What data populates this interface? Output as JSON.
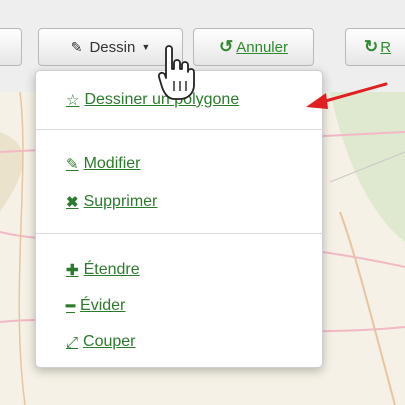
{
  "toolbar": {
    "dessin_label": "Dessin",
    "annuler_label": "Annuler",
    "redo_label": "R"
  },
  "menu": {
    "items": [
      {
        "label": "Dessiner un polygone",
        "icon": "star-icon"
      },
      {
        "label": "Modifier",
        "icon": "edit-icon"
      },
      {
        "label": "Supprimer",
        "icon": "close-icon"
      },
      {
        "label": "Étendre",
        "icon": "plus-icon"
      },
      {
        "label": "Évider",
        "icon": "minus-icon"
      },
      {
        "label": "Couper",
        "icon": "cut-icon"
      }
    ]
  },
  "colors": {
    "link_green": "#2c7a2c",
    "annotation_red": "#e02020",
    "map_bg": "#f5f1e6"
  }
}
